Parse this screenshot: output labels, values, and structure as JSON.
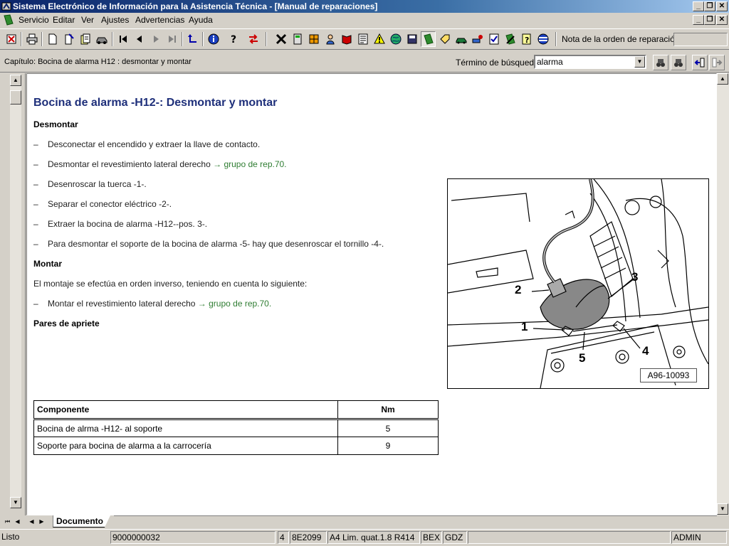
{
  "window": {
    "title": "Sistema Electrónico de Información para la Asistencia Técnica - [Manual de reparaciones]"
  },
  "menu": [
    "Servicio",
    "Editar",
    "Ver",
    "Ajustes",
    "Advertencias",
    "Ayuda"
  ],
  "toolbar": {
    "note_label": "Nota de la orden de reparación:",
    "note_value": "",
    "icons": [
      "exit-icon",
      "print-icon",
      "new-document-icon",
      "properties-icon",
      "documents-icon",
      "vehicle-icon",
      "first-icon",
      "previous-icon",
      "next-icon",
      "last-icon",
      "up-level-icon",
      "info-icon",
      "help-icon",
      "switch-icon",
      "close-icon",
      "calculator-icon",
      "components-icon",
      "person-icon",
      "book-icon",
      "list-icon",
      "warning-icon",
      "globe-icon",
      "save-icon",
      "manual-icon",
      "tag-icon",
      "car-icon",
      "vehicle-info-icon",
      "checklist-icon",
      "service-icon",
      "question-doc-icon",
      "flag-icon"
    ]
  },
  "chapter": {
    "text": "Capítulo: Bocina de alarma H12 : desmontar y montar",
    "search_label": "Término de búsqueda:",
    "search_value": "alarma"
  },
  "document": {
    "title": "Bocina de alarma -H12-: Desmontar y montar",
    "removal_heading": "Desmontar",
    "steps": [
      {
        "text": "Desconectar el encendido y extraer la llave de contacto.",
        "link": ""
      },
      {
        "text": "Desmontar el revestimiento lateral derecho ",
        "link": "→ grupo de rep.70."
      },
      {
        "text": "Desenroscar la tuerca -1-.",
        "link": ""
      },
      {
        "text": "Separar el conector eléctrico -2-.",
        "link": ""
      },
      {
        "text": "Extraer la bocina de alarma -H12--pos. 3-.",
        "link": ""
      },
      {
        "text": "Para desmontar el soporte de la bocina de alarma -5- hay que desenroscar el tornillo -4-.",
        "link": ""
      }
    ],
    "install_heading": "Montar",
    "install_text": "El montaje se efectúa en orden inverso, teniendo en cuenta lo siguiente:",
    "install_steps": [
      {
        "text": "Montar el revestimiento lateral derecho ",
        "link": "→ grupo de rep.70."
      }
    ],
    "torque_heading": "Pares de apriete",
    "figure_ref": "A96-10093",
    "callouts": [
      "1",
      "2",
      "3",
      "4",
      "5"
    ],
    "table": {
      "headers": [
        "Componente",
        "Nm"
      ],
      "rows": [
        [
          "Bocina de alrma -H12- al soporte",
          "5"
        ],
        [
          "Soporte para bocina de alarma a la carrocería",
          "9"
        ]
      ]
    }
  },
  "tabs": {
    "active": "Documento"
  },
  "status": {
    "state": "Listo",
    "order": "9000000032",
    "count": "4",
    "code": "8E2099",
    "model": "A4 Lim. quat.1.8 R414",
    "c1": "BEX",
    "c2": "GDZ",
    "user": "ADMIN"
  }
}
